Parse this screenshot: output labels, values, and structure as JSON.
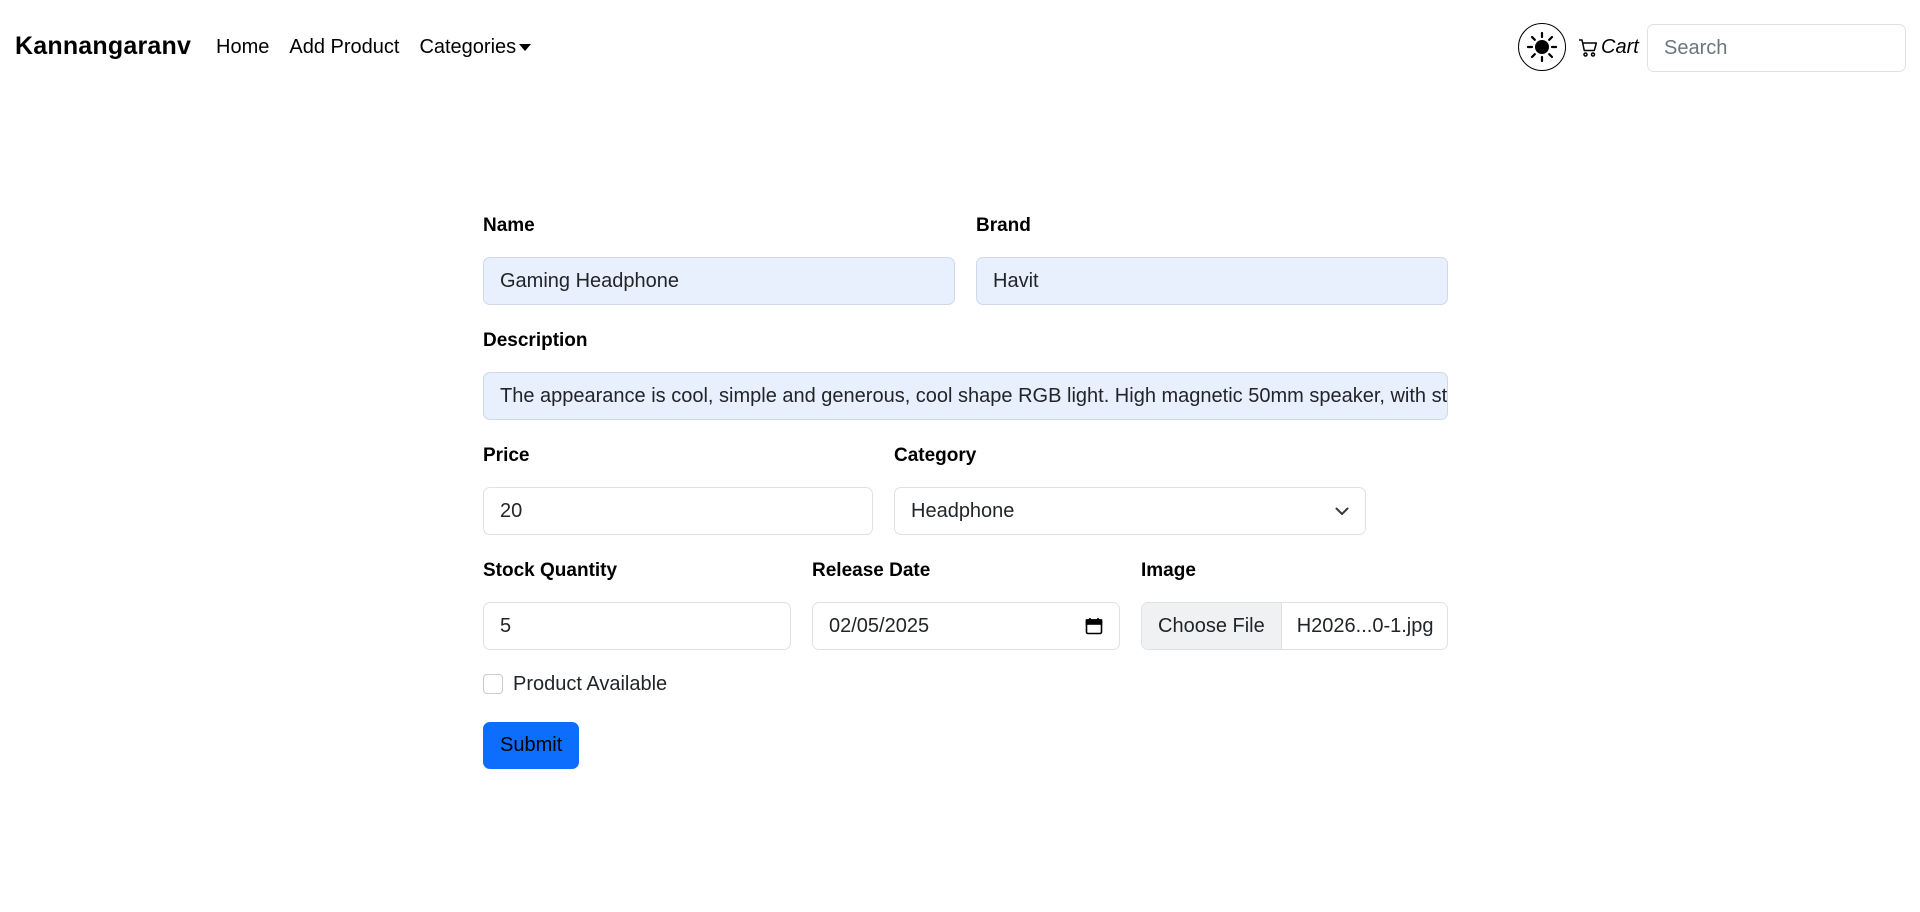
{
  "navbar": {
    "brand": "Kannangaranv",
    "links": [
      "Home",
      "Add Product",
      "Categories"
    ],
    "cart_label": "Cart",
    "search_placeholder": "Search"
  },
  "form": {
    "name": {
      "label": "Name",
      "value": "Gaming Headphone"
    },
    "brand": {
      "label": "Brand",
      "value": "Havit"
    },
    "description": {
      "label": "Description",
      "value": "The appearance is cool, simple and generous, cool shape RGB light. High magnetic 50mm speaker, with st"
    },
    "price": {
      "label": "Price",
      "value": "20"
    },
    "category": {
      "label": "Category",
      "value": "Headphone"
    },
    "stock": {
      "label": "Stock Quantity",
      "value": "5"
    },
    "release_date": {
      "label": "Release Date",
      "value": "02/05/2025"
    },
    "image": {
      "label": "Image",
      "button": "Choose File",
      "file_name": "H2026...0-1.jpg"
    },
    "available": {
      "label": "Product Available",
      "checked": false
    },
    "submit_label": "Submit"
  },
  "colors": {
    "primary": "#0d6efd",
    "autofill": "#e8f0fe",
    "border": "#dee2e6"
  }
}
